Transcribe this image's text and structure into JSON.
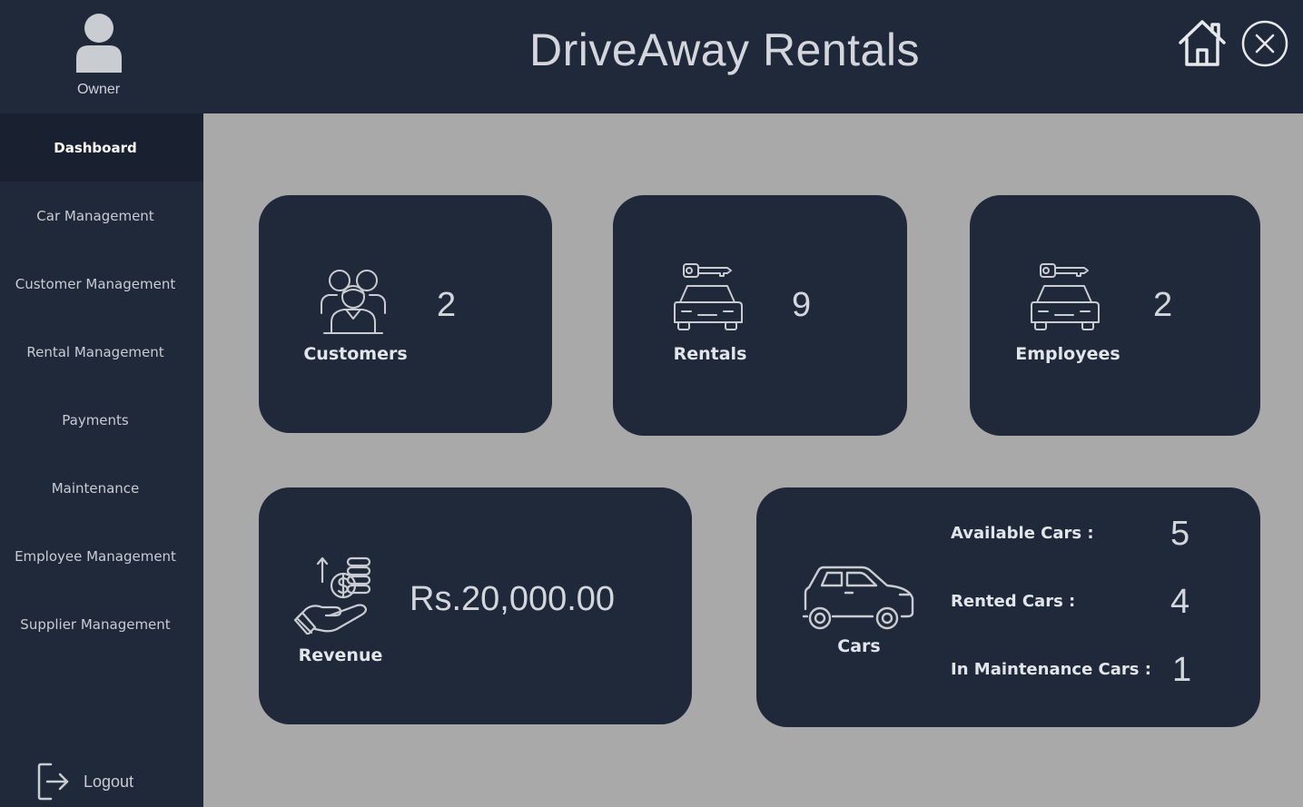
{
  "header": {
    "user_role": "Owner",
    "app_title": "DriveAway Rentals",
    "home_icon": "home-icon",
    "close_icon": "close-icon"
  },
  "sidebar": {
    "items": [
      {
        "label": "Dashboard",
        "active": true
      },
      {
        "label": "Car Management"
      },
      {
        "label": "Customer Management"
      },
      {
        "label": "Rental Management"
      },
      {
        "label": "Payments"
      },
      {
        "label": "Maintenance"
      },
      {
        "label": "Employee Management"
      },
      {
        "label": "Supplier Management"
      }
    ],
    "logout_label": "Logout"
  },
  "cards": {
    "customers": {
      "label": "Customers",
      "count": "2",
      "icon": "customers-icon"
    },
    "rentals": {
      "label": "Rentals",
      "count": "9",
      "icon": "car-key-icon"
    },
    "employees": {
      "label": "Employees",
      "count": "2",
      "icon": "car-key-icon"
    },
    "revenue": {
      "label": "Revenue",
      "amount": "Rs.20,000.00",
      "icon": "revenue-icon"
    },
    "cars": {
      "label": "Cars",
      "icon": "car-icon",
      "available_label": "Available Cars :",
      "available_value": "5",
      "rented_label": "Rented Cars :",
      "rented_value": "4",
      "maintenance_label": "In Maintenance Cars :",
      "maintenance_value": "1"
    }
  },
  "colors": {
    "header_bg": "#1f293a",
    "content_bg": "#a9a9a9",
    "card_bg": "#1f293a",
    "active_nav_bg": "#192130"
  }
}
